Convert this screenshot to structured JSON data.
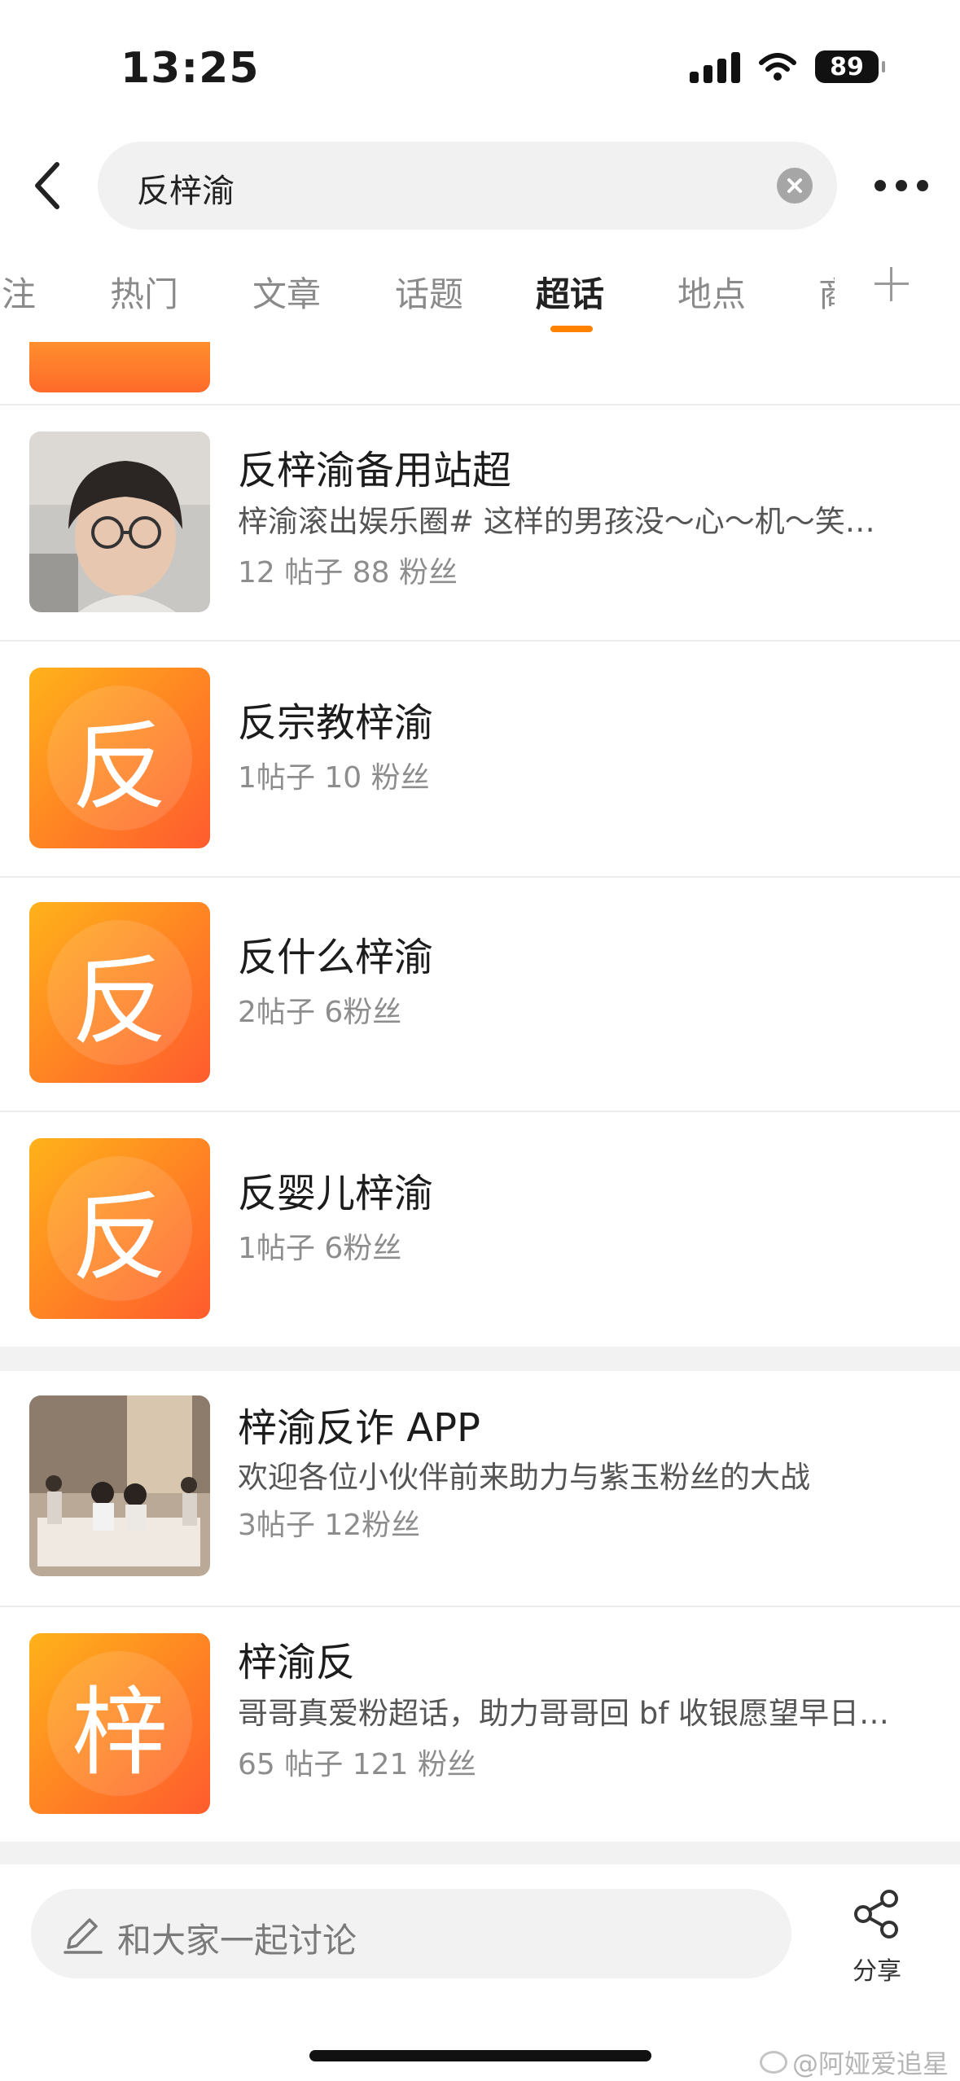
{
  "status": {
    "time": "13:25",
    "battery": "89"
  },
  "search": {
    "query": "反梓渝"
  },
  "tabs": [
    {
      "label": "关注"
    },
    {
      "label": "热门"
    },
    {
      "label": "文章"
    },
    {
      "label": "话题"
    },
    {
      "label": "超话"
    },
    {
      "label": "地点"
    },
    {
      "label": "商"
    }
  ],
  "items": [
    {
      "title": "反梓渝备用站超",
      "desc": "梓渝滚出娱乐圈#   这样的男孩没～心～机～笑…",
      "meta": "12 帖子 88 粉丝",
      "thumb": "photo-boy"
    },
    {
      "title": "反宗教梓渝",
      "desc": "",
      "meta": "1帖子 10 粉丝",
      "thumb_char": "反"
    },
    {
      "title": "反什么梓渝",
      "desc": "",
      "meta": "2帖子 6粉丝",
      "thumb_char": "反"
    },
    {
      "title": "反婴儿梓渝",
      "desc": "",
      "meta": "1帖子 6粉丝",
      "thumb_char": "反"
    },
    {
      "title": "梓渝反诈 APP",
      "desc": "欢迎各位小伙伴前来助力与紫玉粉丝的大战",
      "meta": "3帖子 12粉丝",
      "thumb": "photo-room"
    },
    {
      "title": "梓渝反",
      "desc": "哥哥真爱粉超话，助力哥哥回 bf 收银愿望早日…",
      "meta": "65 帖子 121 粉丝",
      "thumb_char": "梓"
    }
  ],
  "bottom": {
    "comment_placeholder": "和大家一起讨论",
    "share_label": "分享"
  },
  "watermark": "@阿娅爱追星",
  "colors": {
    "accent": "#ff8200",
    "thumb_orange": "#ff8a22"
  }
}
